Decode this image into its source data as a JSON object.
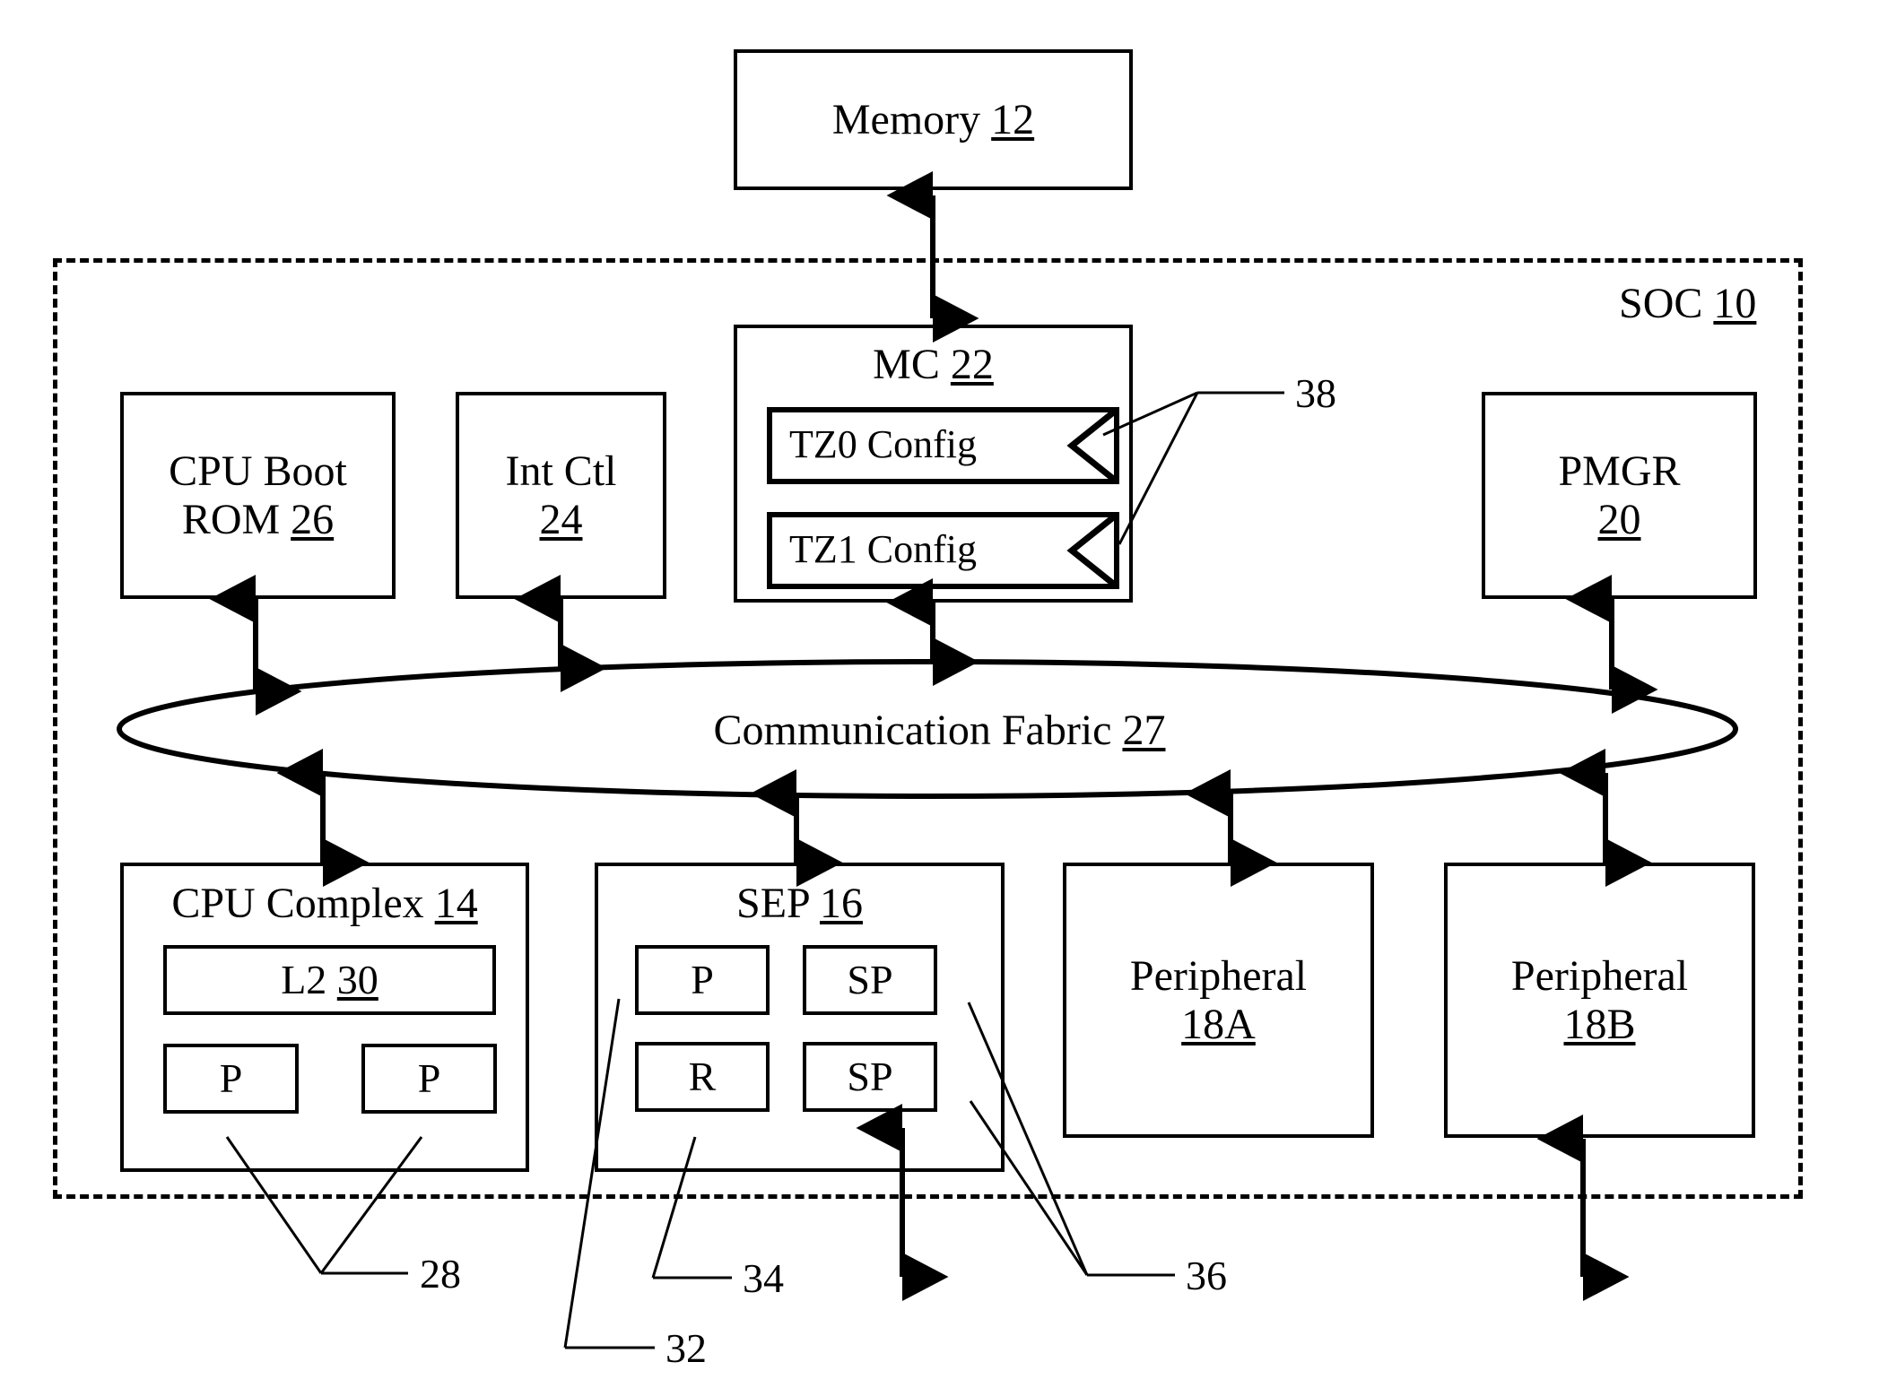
{
  "figure": {
    "type": "patent-block-diagram",
    "subject": "System on a chip (SOC) block diagram"
  },
  "blocks": {
    "memory": {
      "label": "Memory",
      "ref": "12"
    },
    "soc": {
      "label": "SOC",
      "ref": "10"
    },
    "cpu_boot_rom": {
      "line1": "CPU Boot",
      "line2": "ROM",
      "ref": "26"
    },
    "int_ctl": {
      "line1": "Int Ctl",
      "ref": "24"
    },
    "mc": {
      "label": "MC",
      "ref": "22"
    },
    "tz0_config": {
      "label": "TZ0 Config"
    },
    "tz1_config": {
      "label": "TZ1 Config"
    },
    "pmgr": {
      "line1": "PMGR",
      "ref": "20"
    },
    "fabric": {
      "label": "Communication Fabric",
      "ref": "27"
    },
    "cpu_complex": {
      "label": "CPU Complex",
      "ref": "14"
    },
    "l2": {
      "label": "L2",
      "ref": "30"
    },
    "cpu_p0": {
      "label": "P"
    },
    "cpu_p1": {
      "label": "P"
    },
    "sep": {
      "label": "SEP",
      "ref": "16"
    },
    "sep_p": {
      "label": "P"
    },
    "sep_r": {
      "label": "R"
    },
    "sep_sp0": {
      "label": "SP"
    },
    "sep_sp1": {
      "label": "SP"
    },
    "peripheral_a": {
      "line1": "Peripheral",
      "ref": "18A"
    },
    "peripheral_b": {
      "line1": "Peripheral",
      "ref": "18B"
    }
  },
  "callouts": [
    {
      "id": "c28",
      "ref": "28",
      "targets": [
        "cpu_p0",
        "cpu_p1"
      ]
    },
    {
      "id": "c32",
      "ref": "32",
      "targets": [
        "sep_p"
      ]
    },
    {
      "id": "c34",
      "ref": "34",
      "targets": [
        "sep_r"
      ]
    },
    {
      "id": "c36",
      "ref": "36",
      "targets": [
        "sep_sp0",
        "sep_sp1"
      ]
    },
    {
      "id": "c38",
      "ref": "38",
      "targets": [
        "tz0_config",
        "tz1_config"
      ]
    }
  ],
  "colors": {
    "stroke": "#000000",
    "background": "#ffffff"
  }
}
